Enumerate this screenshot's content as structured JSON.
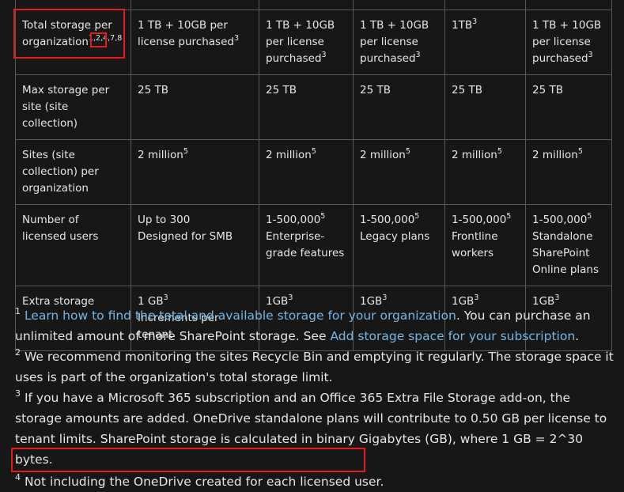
{
  "table": {
    "rows": [
      {
        "label": "Total storage per organization",
        "label_sup": "1,2,4,7,8",
        "cells": [
          {
            "text": "1 TB + 10GB per license purchased",
            "sup": "3"
          },
          {
            "text": "1 TB + 10GB per license purchased",
            "sup": "3"
          },
          {
            "text": "1 TB + 10GB per license purchased",
            "sup": "3"
          },
          {
            "text": "1TB",
            "sup": "3"
          },
          {
            "text": "1 TB + 10GB per license purchased",
            "sup": "3"
          }
        ]
      },
      {
        "label": "Max storage per site (site collection)",
        "cells": [
          {
            "text": "25 TB"
          },
          {
            "text": "25 TB"
          },
          {
            "text": "25 TB"
          },
          {
            "text": "25 TB"
          },
          {
            "text": "25 TB"
          }
        ]
      },
      {
        "label": "Sites (site collection) per organization",
        "cells": [
          {
            "text": "2 million",
            "sup": "5"
          },
          {
            "text": "2 million",
            "sup": "5"
          },
          {
            "text": "2 million",
            "sup": "5"
          },
          {
            "text": "2 million",
            "sup": "5"
          },
          {
            "text": "2 million",
            "sup": "5"
          }
        ]
      },
      {
        "label": "Number of licensed users",
        "cells": [
          {
            "text": "Up to 300",
            "line2": "Designed for SMB"
          },
          {
            "text": "1-500,000",
            "sup": "5",
            "line2": "Enterprise-grade features"
          },
          {
            "text": "1-500,000",
            "sup": "5",
            "line2": "Legacy plans"
          },
          {
            "text": "1-500,000",
            "sup": "5",
            "line2": "Frontline workers"
          },
          {
            "text": "1-500,000",
            "sup": "5",
            "line2": "Standalone SharePoint Online plans"
          }
        ]
      },
      {
        "label": "Extra storage",
        "cells": [
          {
            "text": "1 GB",
            "sup": "3",
            "line2": "Increments per tenant"
          },
          {
            "text": "1GB",
            "sup": "3"
          },
          {
            "text": "1GB",
            "sup": "3"
          },
          {
            "text": "1GB",
            "sup": "3"
          },
          {
            "text": "1GB",
            "sup": "3"
          }
        ]
      }
    ]
  },
  "notes": {
    "n1": {
      "num": "1",
      "link1": "Learn how to find the total and available storage for your organization",
      "text1": ". You can purchase an unlimited amount of more SharePoint storage. See ",
      "link2": "Add storage space for your subscription",
      "text2": "."
    },
    "n2": {
      "num": "2",
      "text": "We recommend monitoring the sites Recycle Bin and emptying it regularly. The storage space it uses is part of the organization's total storage limit."
    },
    "n3": {
      "num": "3",
      "text": "If you have a Microsoft 365 subscription and an Office 365 Extra File Storage add-on, the storage amounts are added. OneDrive standalone plans will contribute to 0.50 GB per license to tenant limits. SharePoint storage is calculated in binary Gigabytes (GB), where 1 GB = 2^30 bytes."
    },
    "n4": {
      "num": "4",
      "text": "Not including the OneDrive created for each licensed user."
    }
  },
  "colors": {
    "background": "#171717",
    "text": "#e6e6e6",
    "link": "#75b6e7",
    "highlight": "#e21b1b",
    "border": "#5a5a5a"
  }
}
